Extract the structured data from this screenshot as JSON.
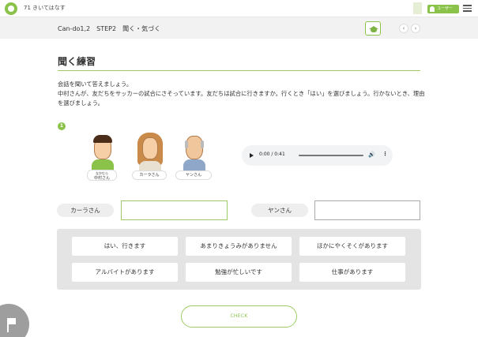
{
  "header": {
    "app_title": "71 きいてはなす",
    "user_label": "ユーザー"
  },
  "stepbar": {
    "title": "Can-do1,2　STEP2　聞く・気づく",
    "prev": "‹",
    "next": "›"
  },
  "section": {
    "title": "聞く練習",
    "instructions": [
      "会話を聞いて答えましょう。",
      "中村さんが、友だちをサッカーの試合にさそっています。友だちは試合に行きますか。行くとき「はい」を選びましょう。行かないとき、理由を選びましょう。"
    ]
  },
  "question": {
    "number": "1",
    "characters": [
      {
        "name": "中村さん",
        "ruby": "なかむら"
      },
      {
        "name": "カーラさん"
      },
      {
        "name": "ヤンさん"
      }
    ]
  },
  "audio": {
    "time": "0:00 / 0:41"
  },
  "answers": [
    {
      "label": "カーラさん",
      "value": ""
    },
    {
      "label": "ヤンさん",
      "value": ""
    }
  ],
  "choices": [
    "はい、行きます",
    "あまりきょうみがありません",
    "ほかにやくそくがあります",
    "アルバイトがあります",
    "勉強が忙しいです",
    "仕事があります"
  ],
  "check_label": "CHECK",
  "colors": {
    "accent": "#8bc34a",
    "panel": "#e4e4e4",
    "stepbar": "#f2f2f2"
  }
}
